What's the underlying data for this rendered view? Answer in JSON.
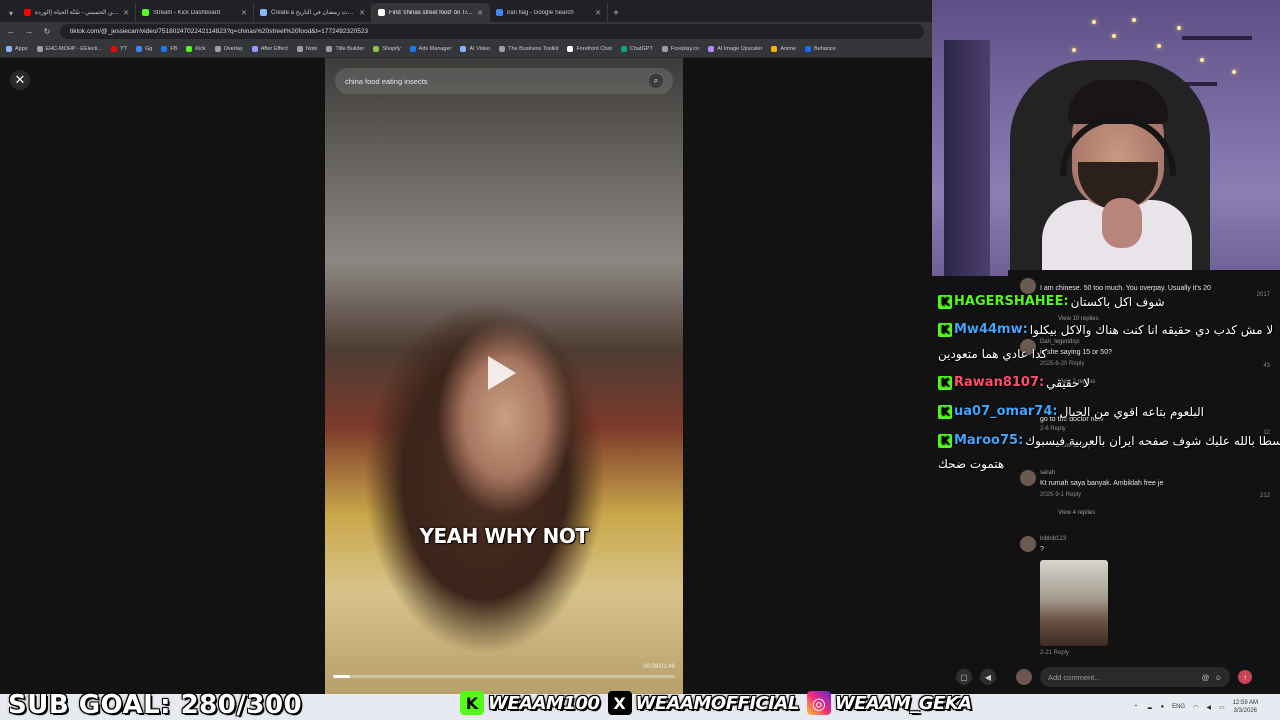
{
  "browser": {
    "tabs": [
      {
        "title": "حسين الحسيني - سُنّة الحياة (الوردة...",
        "color": "#ff0000",
        "active": false
      },
      {
        "title": "Stream - Kick Dashboard",
        "color": "#53fc18",
        "active": false
      },
      {
        "title": "Create a ثلاث ثلاثات رمضان في التاريخ",
        "color": "#8ab4f8",
        "active": false
      },
      {
        "title": "Find 'chinas street food' on TikTok",
        "color": "#ffffff",
        "active": true
      },
      {
        "title": "iran flag - Google Search",
        "color": "#4285f4",
        "active": false
      }
    ],
    "new_tab": "+",
    "url": "tiktok.com/@_jessiecarr/video/7518024702242114823?q=chinas%20street%20food&t=1772492320523",
    "bookmarks": [
      "Apps",
      "EHC-MOHP - EElecti...",
      "YT",
      "Gg",
      "FB",
      "Kick",
      "Overlay",
      "After Effect",
      "Note",
      "Title Builder",
      "Shopify",
      "Ads Manager",
      "AI Video",
      "The Business Toolkit",
      "Forefront Chat",
      "ChatGPT",
      "Foreplay.co",
      "AI Image Upscaler",
      "Anime",
      "Behance"
    ]
  },
  "video": {
    "search_query": "china food eating insects",
    "caption": "YEAH WHY NOT",
    "time": "00:06/01:49",
    "progress": 0.05
  },
  "comments": [
    {
      "user": "",
      "text": "I am chinese. 50 too much. You overpay. Usually it's 20",
      "meta": "",
      "likes": "2017",
      "replies": "View 10 replies"
    },
    {
      "user": "Dan_legendsjc",
      "text": "is she saying 15 or 50?",
      "meta": "2025-6-20   Reply",
      "likes": "43",
      "replies": "View 2 replies"
    },
    {
      "user": "",
      "text": "go to the doctor now",
      "meta": "2-6   Reply",
      "likes": "12",
      "replies": "View 1 reply"
    },
    {
      "user": "sarah",
      "text": "Kt rumah saya banyak. Ambiklah free je",
      "meta": "2025-9-1   Reply",
      "likes": "212",
      "replies": "View 4 replies"
    },
    {
      "user": "loblob123",
      "text": "?",
      "meta": "2-21   Reply",
      "likes": "",
      "replies": ""
    }
  ],
  "comment_bar": {
    "placeholder": "Add comment...",
    "at": "@",
    "emoji": "☺",
    "post": "↑"
  },
  "chat": [
    {
      "user": "HAGERSHAHEE:",
      "color": "#53fc18",
      "msg": "شوف اكل باكستان"
    },
    {
      "user": "Mw44mw:",
      "color": "#3ea6ff",
      "msg": "لا مش كدب دي حقيقه انا كنت هناك والاكل بيكلوا",
      "cont": "كدا عادي هما متعودين"
    },
    {
      "user": "Rawan8107:",
      "color": "#ff4d6a",
      "msg": "لا حقيقي"
    },
    {
      "user": "ua07_omar74:",
      "color": "#3ea6ff",
      "msg": "البلعوم بتاعه اقوي من الجبال"
    },
    {
      "user": "Maroo75:",
      "color": "#3ea6ff",
      "msg": "يسطا بالله عليك شوف صفحه ايران بالعربية فيسبوك",
      "cont": "هتموت ضحك"
    }
  ],
  "overlay": {
    "subgoal": "SUB GOAL: 280/300",
    "kick": "WEAAM100",
    "x": "WEAAMOFFICIAL",
    "instagram": "WEAAM_GEKA"
  },
  "tray": {
    "lang": "ENG",
    "time": "12:59 AM",
    "date": "3/3/2026"
  }
}
